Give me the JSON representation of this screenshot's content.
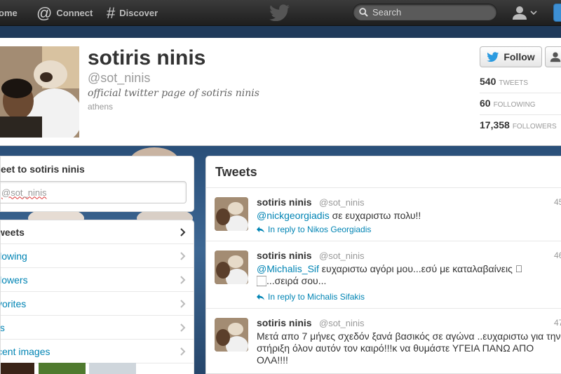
{
  "topbar": {
    "home_label": "ome",
    "connect_label": "Connect",
    "discover_label": "Discover",
    "search_placeholder": "Search"
  },
  "profile": {
    "name": "sotiris ninis",
    "handle": "@sot_ninis",
    "bio": "official twitter page of sotiris ninis",
    "location": "athens",
    "follow_label": "Follow",
    "stats": [
      {
        "value": "540",
        "label": "TWEETS"
      },
      {
        "value": "60",
        "label": "FOLLOWING"
      },
      {
        "value": "17,358",
        "label": "FOLLOWERS"
      }
    ]
  },
  "tweet_to": {
    "title": "eet to sotiris ninis",
    "input_value": "@sot_ninis"
  },
  "side_nav": [
    {
      "label": "weets",
      "active": true
    },
    {
      "label": "llowing",
      "active": false
    },
    {
      "label": "llowers",
      "active": false
    },
    {
      "label": "vorites",
      "active": false
    },
    {
      "label": "ts",
      "active": false
    },
    {
      "label": "cent images",
      "active": false
    }
  ],
  "tweets_panel": {
    "title": "Tweets",
    "items": [
      {
        "name": "sotiris ninis",
        "handle": "@sot_ninis",
        "time": "45",
        "mention": "@nickgeorgiadis",
        "text": " σε ευχαριστω πολυ!!",
        "reply": "In reply to Nikos Georgiadis"
      },
      {
        "name": "sotiris ninis",
        "handle": "@sot_ninis",
        "time": "46",
        "mention": "@Michalis_Sif",
        "text": " ευχαριστω αγόρι μου...εσύ με καταλαβαίνεις 🏻🏻...σειρά σου...",
        "reply": "In reply to Michalis Sifakis"
      },
      {
        "name": "sotiris ninis",
        "handle": "@sot_ninis",
        "time": "47",
        "mention": "",
        "text": "Μετά απο 7 μήνες σχεδόν ξανά βασικός σε αγώνα ..ευχαριστω για την στήριξη όλον αυτόν τον καιρό!!!κ να θυμάστε ΥΓΕΙΑ ΠΑΝΩ ΑΠΟ ΟΛΑ!!!!",
        "reply": ""
      }
    ]
  },
  "colors": {
    "link": "#0084b4",
    "topbar": "#2b2b2b",
    "accent": "#3d8fd4"
  }
}
